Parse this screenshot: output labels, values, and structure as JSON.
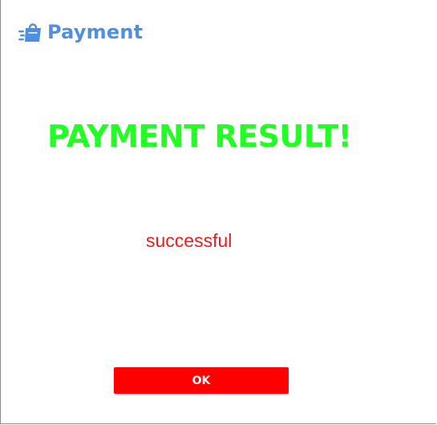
{
  "brand": {
    "icon": "shopping-bag-icon",
    "name": "Payment",
    "color": "#4f8fe0"
  },
  "result": {
    "title": "PAYMENT RESULT!",
    "title_color": "#22ff22",
    "status": "successful",
    "status_color": "#e8201b"
  },
  "actions": {
    "ok_label": "OK",
    "ok_color": "#ff0000"
  }
}
